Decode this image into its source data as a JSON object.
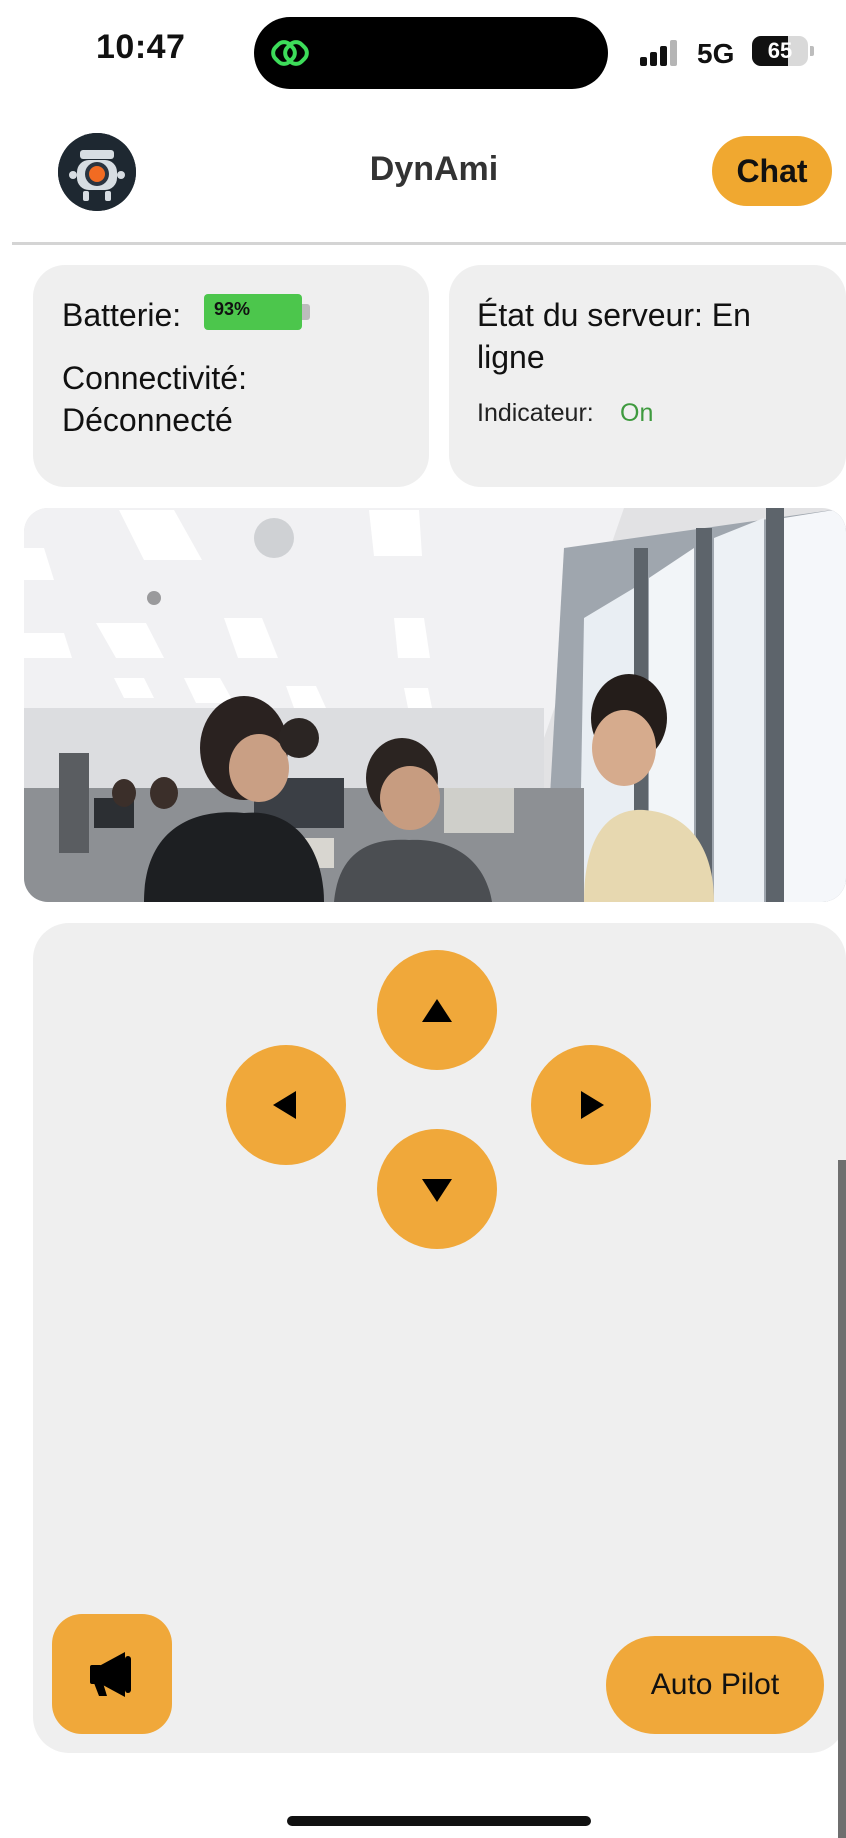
{
  "status_bar": {
    "time": "10:47",
    "network": "5G",
    "battery_level": "65",
    "battery_fraction": 0.65,
    "island_icon": "link-icon",
    "island_icon_color": "#3ddc5a"
  },
  "header": {
    "title": "DynAmi",
    "chat_label": "Chat",
    "logo_icon": "robot-logo-icon",
    "accent_color": "#f0a830"
  },
  "status_card": {
    "battery_label": "Batterie:",
    "battery_value": "93%",
    "battery_fraction": 0.93,
    "connectivity_label": "Connectivité:",
    "connectivity_value": "Déconnecté"
  },
  "server_card": {
    "server_line1": "État du serveur: En",
    "server_line2": "ligne",
    "indicator_label": "Indicateur:",
    "indicator_value": "On",
    "indicator_color": "#3e9a3e"
  },
  "camera": {
    "feed_icon": "camera-feed"
  },
  "controls": {
    "up_icon": "arrow-up-icon",
    "left_icon": "arrow-left-icon",
    "right_icon": "arrow-right-icon",
    "down_icon": "arrow-down-icon",
    "horn_icon": "megaphone-icon",
    "autopilot_label": "Auto Pilot",
    "button_color": "#f0a83a"
  }
}
